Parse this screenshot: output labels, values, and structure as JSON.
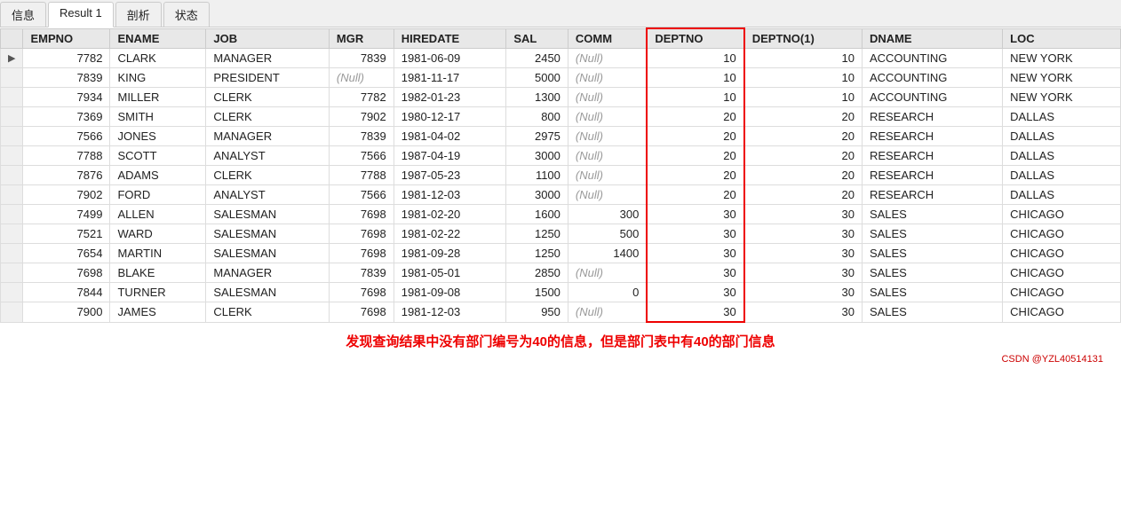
{
  "tabs": [
    {
      "label": "信息",
      "active": false
    },
    {
      "label": "Result 1",
      "active": true
    },
    {
      "label": "剖析",
      "active": false
    },
    {
      "label": "状态",
      "active": false
    }
  ],
  "columns": [
    {
      "key": "marker",
      "label": ""
    },
    {
      "key": "empno",
      "label": "EMPNO"
    },
    {
      "key": "ename",
      "label": "ENAME"
    },
    {
      "key": "job",
      "label": "JOB"
    },
    {
      "key": "mgr",
      "label": "MGR"
    },
    {
      "key": "hiredate",
      "label": "HIREDATE"
    },
    {
      "key": "sal",
      "label": "SAL"
    },
    {
      "key": "comm",
      "label": "COMM"
    },
    {
      "key": "deptno",
      "label": "DEPTNO"
    },
    {
      "key": "deptno1",
      "label": "DEPTNO(1)"
    },
    {
      "key": "dname",
      "label": "DNAME"
    },
    {
      "key": "loc",
      "label": "LOC"
    }
  ],
  "rows": [
    {
      "marker": "▶",
      "empno": "7782",
      "ename": "CLARK",
      "job": "MANAGER",
      "mgr": "7839",
      "hiredate": "1981-06-09",
      "sal": "2450",
      "comm": "(Null)",
      "deptno": "10",
      "deptno1": "10",
      "dname": "ACCOUNTING",
      "loc": "NEW YORK"
    },
    {
      "marker": "",
      "empno": "7839",
      "ename": "KING",
      "job": "PRESIDENT",
      "mgr": "(Null)",
      "hiredate": "1981-11-17",
      "sal": "5000",
      "comm": "(Null)",
      "deptno": "10",
      "deptno1": "10",
      "dname": "ACCOUNTING",
      "loc": "NEW YORK"
    },
    {
      "marker": "",
      "empno": "7934",
      "ename": "MILLER",
      "job": "CLERK",
      "mgr": "7782",
      "hiredate": "1982-01-23",
      "sal": "1300",
      "comm": "(Null)",
      "deptno": "10",
      "deptno1": "10",
      "dname": "ACCOUNTING",
      "loc": "NEW YORK"
    },
    {
      "marker": "",
      "empno": "7369",
      "ename": "SMITH",
      "job": "CLERK",
      "mgr": "7902",
      "hiredate": "1980-12-17",
      "sal": "800",
      "comm": "(Null)",
      "deptno": "20",
      "deptno1": "20",
      "dname": "RESEARCH",
      "loc": "DALLAS"
    },
    {
      "marker": "",
      "empno": "7566",
      "ename": "JONES",
      "job": "MANAGER",
      "mgr": "7839",
      "hiredate": "1981-04-02",
      "sal": "2975",
      "comm": "(Null)",
      "deptno": "20",
      "deptno1": "20",
      "dname": "RESEARCH",
      "loc": "DALLAS"
    },
    {
      "marker": "",
      "empno": "7788",
      "ename": "SCOTT",
      "job": "ANALYST",
      "mgr": "7566",
      "hiredate": "1987-04-19",
      "sal": "3000",
      "comm": "(Null)",
      "deptno": "20",
      "deptno1": "20",
      "dname": "RESEARCH",
      "loc": "DALLAS"
    },
    {
      "marker": "",
      "empno": "7876",
      "ename": "ADAMS",
      "job": "CLERK",
      "mgr": "7788",
      "hiredate": "1987-05-23",
      "sal": "1100",
      "comm": "(Null)",
      "deptno": "20",
      "deptno1": "20",
      "dname": "RESEARCH",
      "loc": "DALLAS"
    },
    {
      "marker": "",
      "empno": "7902",
      "ename": "FORD",
      "job": "ANALYST",
      "mgr": "7566",
      "hiredate": "1981-12-03",
      "sal": "3000",
      "comm": "(Null)",
      "deptno": "20",
      "deptno1": "20",
      "dname": "RESEARCH",
      "loc": "DALLAS"
    },
    {
      "marker": "",
      "empno": "7499",
      "ename": "ALLEN",
      "job": "SALESMAN",
      "mgr": "7698",
      "hiredate": "1981-02-20",
      "sal": "1600",
      "comm": "300",
      "deptno": "30",
      "deptno1": "30",
      "dname": "SALES",
      "loc": "CHICAGO"
    },
    {
      "marker": "",
      "empno": "7521",
      "ename": "WARD",
      "job": "SALESMAN",
      "mgr": "7698",
      "hiredate": "1981-02-22",
      "sal": "1250",
      "comm": "500",
      "deptno": "30",
      "deptno1": "30",
      "dname": "SALES",
      "loc": "CHICAGO"
    },
    {
      "marker": "",
      "empno": "7654",
      "ename": "MARTIN",
      "job": "SALESMAN",
      "mgr": "7698",
      "hiredate": "1981-09-28",
      "sal": "1250",
      "comm": "1400",
      "deptno": "30",
      "deptno1": "30",
      "dname": "SALES",
      "loc": "CHICAGO"
    },
    {
      "marker": "",
      "empno": "7698",
      "ename": "BLAKE",
      "job": "MANAGER",
      "mgr": "7839",
      "hiredate": "1981-05-01",
      "sal": "2850",
      "comm": "(Null)",
      "deptno": "30",
      "deptno1": "30",
      "dname": "SALES",
      "loc": "CHICAGO"
    },
    {
      "marker": "",
      "empno": "7844",
      "ename": "TURNER",
      "job": "SALESMAN",
      "mgr": "7698",
      "hiredate": "1981-09-08",
      "sal": "1500",
      "comm": "0",
      "deptno": "30",
      "deptno1": "30",
      "dname": "SALES",
      "loc": "CHICAGO"
    },
    {
      "marker": "",
      "empno": "7900",
      "ename": "JAMES",
      "job": "CLERK",
      "mgr": "7698",
      "hiredate": "1981-12-03",
      "sal": "950",
      "comm": "(Null)",
      "deptno": "30",
      "deptno1": "30",
      "dname": "SALES",
      "loc": "CHICAGO"
    }
  ],
  "footer": {
    "note": "发现查询结果中没有部门编号为40的信息，但是部门表中有40的部门信息",
    "watermark": "CSDN @YZL40514131"
  }
}
